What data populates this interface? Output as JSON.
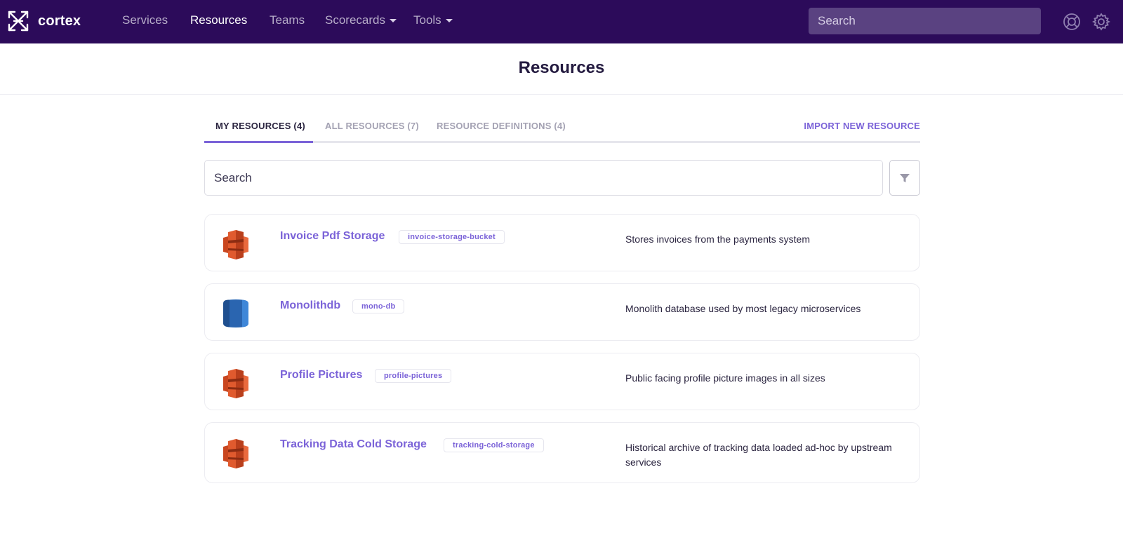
{
  "app": {
    "name": "cortex"
  },
  "nav": {
    "items": [
      {
        "label": "Services",
        "active": false,
        "dropdown": false
      },
      {
        "label": "Resources",
        "active": true,
        "dropdown": false
      },
      {
        "label": "Teams",
        "active": false,
        "dropdown": false
      },
      {
        "label": "Scorecards",
        "active": false,
        "dropdown": true
      },
      {
        "label": "Tools",
        "active": false,
        "dropdown": true
      }
    ],
    "search_placeholder": "Search",
    "icons": [
      "help-lifebuoy-icon",
      "settings-gear-icon"
    ]
  },
  "page": {
    "title": "Resources"
  },
  "tabs": {
    "items": [
      {
        "label": "MY RESOURCES (4)",
        "active": true
      },
      {
        "label": "ALL RESOURCES (7)",
        "active": false
      },
      {
        "label": "RESOURCE DEFINITIONS (4)",
        "active": false
      }
    ],
    "import_label": "IMPORT NEW RESOURCE"
  },
  "search": {
    "placeholder": "Search",
    "filter_icon": "filter-funnel-icon"
  },
  "resources": [
    {
      "name": "Invoice Pdf Storage",
      "tag": "invoice-storage-bucket",
      "description": "Stores invoices from the payments system",
      "icon": "s3-bucket-icon"
    },
    {
      "name": "Monolithdb",
      "tag": "mono-db",
      "description": "Monolith database used by most legacy microservices",
      "icon": "rds-database-icon"
    },
    {
      "name": "Profile Pictures",
      "tag": "profile-pictures",
      "description": "Public facing profile picture images in all sizes",
      "icon": "s3-bucket-icon"
    },
    {
      "name": "Tracking Data Cold Storage",
      "tag": "tracking-cold-storage",
      "description": "Historical archive of tracking data loaded ad-hoc by upstream services",
      "icon": "s3-bucket-icon"
    }
  ],
  "colors": {
    "nav_bg": "#2c0b5a",
    "accent": "#7b63d8",
    "s3_orange": "#e05a2e",
    "rds_blue": "#2f6fbf"
  }
}
